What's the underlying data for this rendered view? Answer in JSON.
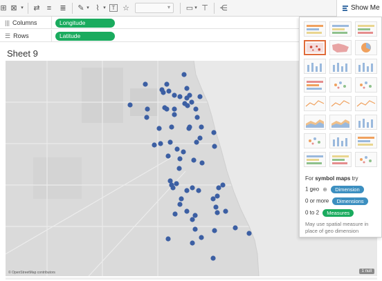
{
  "toolbar": {
    "show_me_label": "Show Me"
  },
  "shelves": {
    "columns": {
      "label": "Columns",
      "pill": "Longitude"
    },
    "rows": {
      "label": "Rows",
      "pill": "Latitude"
    }
  },
  "sheet": {
    "title": "Sheet 9",
    "attribution": "© OpenStreetMap contributors",
    "nulls_badge": "1 null"
  },
  "show_me": {
    "hint_prefix": "For ",
    "hint_bold": "symbol maps",
    "hint_suffix": " try",
    "requirements": [
      {
        "prefix": "1 geo",
        "joiner": "⊕",
        "chip": "Dimension",
        "color": "#3c8fc0"
      },
      {
        "prefix": "0 or more",
        "joiner": "",
        "chip": "Dimensions",
        "color": "#3c8fc0"
      },
      {
        "prefix": "0 to 2",
        "joiner": "",
        "chip": "Measures",
        "color": "#1aab5e"
      }
    ],
    "note": "May use spatial measure in place of geo dimension",
    "selected_chart": "symbol-map"
  },
  "colors": {
    "mark": "#3c5fa3",
    "pill_green": "#1aab5e",
    "pill_blue": "#3c8fc0",
    "selected_border": "#e06b3a"
  }
}
